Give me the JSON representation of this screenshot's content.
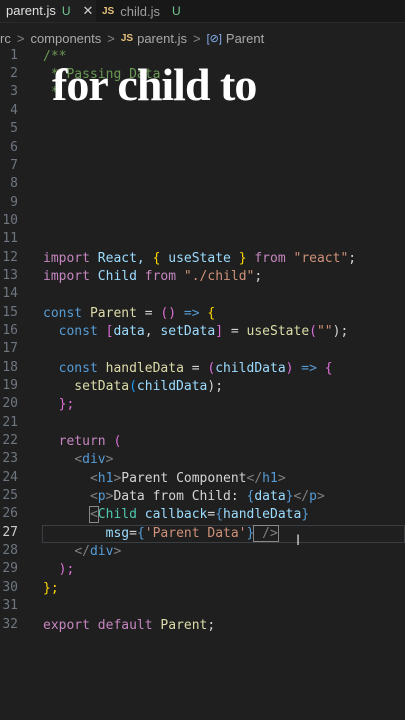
{
  "tabs": [
    {
      "icon": "JS",
      "label": "parent.js",
      "status": "U",
      "close": "✕"
    },
    {
      "icon": "JS",
      "label": "child.js",
      "status": "U"
    }
  ],
  "breadcrumb": {
    "items": [
      "rc",
      "components",
      "parent.js",
      "Parent"
    ],
    "sep": ">",
    "js": "JS",
    "sym": "[⊘]"
  },
  "overlay_text": "for child to",
  "line_numbers": [
    "1",
    "2",
    "3",
    "4",
    "5",
    "6",
    "7",
    "8",
    "9",
    "10",
    "11",
    "12",
    "13",
    "14",
    "15",
    "16",
    "17",
    "18",
    "19",
    "20",
    "21",
    "22",
    "23",
    "24",
    "25",
    "26",
    "27",
    "28",
    "29",
    "30",
    "31",
    "32"
  ],
  "current_line": "27",
  "code": {
    "l1": "/**",
    "l2": " * ",
    "l2b": "Passing Data",
    "l3": " *",
    "l12": [
      "import",
      " React, ",
      "{",
      " useState ",
      "}",
      " from ",
      "\"react\"",
      ";"
    ],
    "l13": [
      "import",
      " Child",
      " from ",
      "\"./child\"",
      ";"
    ],
    "l15": [
      "const",
      " Parent",
      " = ",
      "()",
      " => ",
      "{"
    ],
    "l16": [
      "  const",
      " [",
      "data",
      ", ",
      "setData",
      "]",
      " = ",
      "useState",
      "(",
      "\"\"",
      ");"
    ],
    "l18": [
      "  const",
      " handleData",
      " = ",
      "(",
      "childData",
      ")",
      " => ",
      "{"
    ],
    "l19": [
      "    setData",
      "(",
      "childData",
      ");"
    ],
    "l20": [
      "  };"
    ],
    "l22": [
      "  return",
      " ("
    ],
    "l23": [
      "    ",
      "<",
      "div",
      ">"
    ],
    "l24": [
      "      ",
      "<",
      "h1",
      ">",
      "Parent Component",
      "</",
      "h1",
      ">"
    ],
    "l25": [
      "      ",
      "<",
      "p",
      ">",
      "Data from Child: ",
      "{",
      "data",
      "}",
      "</",
      "p",
      ">"
    ],
    "l26": [
      "      ",
      "<",
      "Child",
      " callback",
      "=",
      "{",
      "handleData",
      "}"
    ],
    "l27": [
      "        ",
      "msg",
      "=",
      "{",
      "'Parent Data'",
      "}",
      " />"
    ],
    "l28": [
      "    ",
      "</",
      "div",
      ">"
    ],
    "l29": [
      "  );"
    ],
    "l30": [
      "};"
    ],
    "l32": [
      "export",
      " default",
      " Parent",
      ";"
    ]
  },
  "mouse_cursor": "I"
}
